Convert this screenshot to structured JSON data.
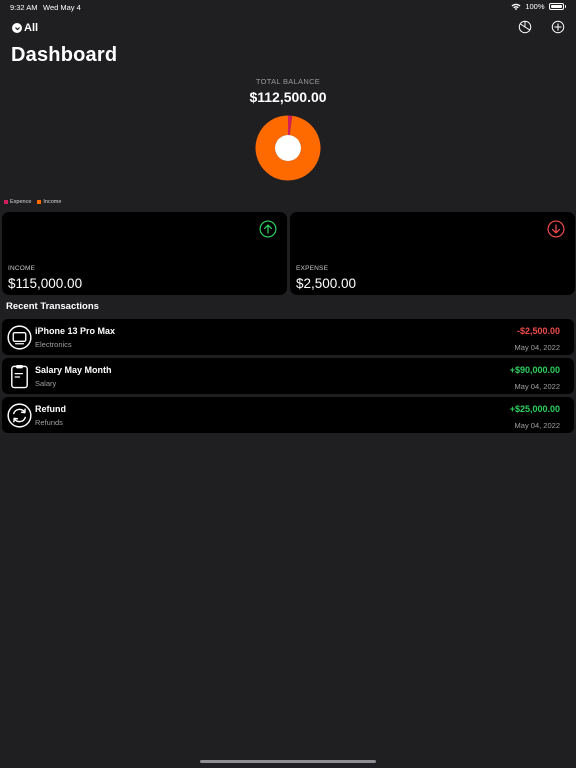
{
  "status": {
    "time": "9:32 AM",
    "date": "Wed May 4",
    "battery": "100%"
  },
  "nav": {
    "filter_label": "All",
    "settings_icon": "chart-pie-icon",
    "add_icon": "plus-circle-icon"
  },
  "page_title": "Dashboard",
  "balance": {
    "label": "TOTAL BALANCE",
    "value": "$112,500.00"
  },
  "chart_data": {
    "type": "pie",
    "slices": [
      {
        "name": "Expence",
        "value": 2500,
        "color": "#d0205a"
      },
      {
        "name": "Income",
        "value": 115000,
        "color": "#ff6a00"
      }
    ]
  },
  "legend": [
    {
      "label": "Expence",
      "color": "#d0205a"
    },
    {
      "label": "Income",
      "color": "#ff6a00"
    }
  ],
  "cards": {
    "income": {
      "label": "INCOME",
      "value": "$115,000.00",
      "icon": "arrow-up-circle-icon",
      "color": "#2fd05e"
    },
    "expense": {
      "label": "EXPENSE",
      "value": "$2,500.00",
      "icon": "arrow-down-circle-icon",
      "color": "#ef4b4b"
    }
  },
  "recent_title": "Recent Transactions",
  "transactions": [
    {
      "name": "iPhone 13 Pro Max",
      "category": "Electronics",
      "amount": "-$2,500.00",
      "date": "May 04, 2022",
      "icon": "monitor-icon"
    },
    {
      "name": "Salary May Month",
      "category": "Salary",
      "amount": "+$90,000.00",
      "date": "May 04, 2022",
      "icon": "clipboard-icon"
    },
    {
      "name": "Refund",
      "category": "Refunds",
      "amount": "+$25,000.00",
      "date": "May 04, 2022",
      "icon": "refresh-icon"
    }
  ]
}
